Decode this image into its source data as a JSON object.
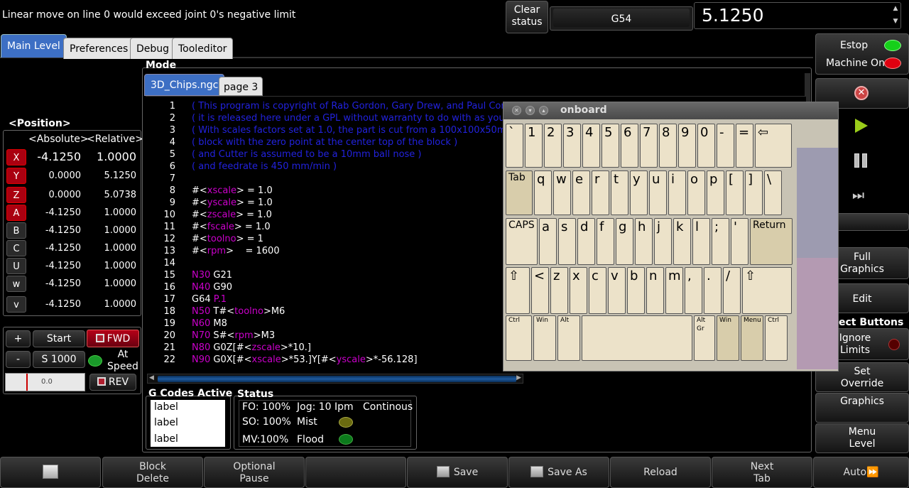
{
  "status_message": "Linear move on line 0 would exceed joint 0's negative limit",
  "clear_status": [
    "Clear",
    "status"
  ],
  "coord_system": "G54",
  "spindle_entry": "5.1250",
  "tabs": [
    "Main Level",
    "Preferences",
    "Debug",
    "Tooleditor"
  ],
  "position": {
    "title": "<Position>",
    "col_absolute": "<Absolute>",
    "col_relative": "<Relative>",
    "axes": [
      {
        "axis": "X",
        "abs": "-4.1250",
        "rel": "1.0000"
      },
      {
        "axis": "Y",
        "abs": "0.0000",
        "rel": "5.1250"
      },
      {
        "axis": "Z",
        "abs": "0.0000",
        "rel": "5.0738"
      },
      {
        "axis": "A",
        "abs": "-4.1250",
        "rel": "1.0000"
      },
      {
        "axis": "B",
        "abs": "-4.1250",
        "rel": "1.0000"
      },
      {
        "axis": "C",
        "abs": "-4.1250",
        "rel": "1.0000"
      },
      {
        "axis": "U",
        "abs": "-4.1250",
        "rel": "1.0000"
      },
      {
        "axis": "w",
        "abs": "-4.1250",
        "rel": "1.0000"
      },
      {
        "axis": "v",
        "abs": "-4.1250",
        "rel": "1.0000"
      }
    ]
  },
  "jog": {
    "plus": "+",
    "minus": "-",
    "start": "Start",
    "spindle_speed": "S 1000",
    "fwd": "FWD",
    "rev": "REV",
    "at_speed": [
      "At",
      "Speed"
    ],
    "slider_value": "0.0"
  },
  "mode": {
    "title": "Mode",
    "file_tab": "3D_Chips.ngc",
    "page_tab": "page 3"
  },
  "gcode_active": {
    "title": "G Codes Active",
    "items": [
      "label",
      "label",
      "label"
    ]
  },
  "status": {
    "title": "Status",
    "fo": "FO: 100%",
    "jog": "Jog: 10 Ipm",
    "mode": "Continous",
    "so": "SO: 100%",
    "mist": "Mist",
    "mv": "MV:100%",
    "flood": "Flood"
  },
  "right_panel": {
    "estop": "Estop",
    "machine_on": "Machine On",
    "full_graphics": [
      "Full",
      "Graphics"
    ],
    "edit": "Edit",
    "select_buttons": "ect Buttons",
    "ignore_limits": [
      "Ignore",
      "Limits"
    ],
    "set_override": [
      "Set",
      "Override"
    ],
    "graphics": "Graphics",
    "menu_level": [
      "Menu",
      "Level"
    ]
  },
  "bottom_bar": {
    "block_delete": [
      "Block",
      "Delete"
    ],
    "optional_pause": [
      "Optional",
      "Pause"
    ],
    "save": "Save",
    "save_as": "Save As",
    "reload": "Reload",
    "next_tab": [
      "Next",
      "Tab"
    ],
    "auto": "Auto"
  },
  "keyboard": {
    "title": "onboard",
    "row1": [
      "`",
      "1",
      "2",
      "3",
      "4",
      "5",
      "6",
      "7",
      "8",
      "9",
      "0",
      "-",
      "="
    ],
    "row2": [
      "Tab",
      "q",
      "w",
      "e",
      "r",
      "t",
      "y",
      "u",
      "i",
      "o",
      "p",
      "[",
      "]",
      "\\"
    ],
    "row3": [
      "CAPS",
      "a",
      "s",
      "d",
      "f",
      "g",
      "h",
      "j",
      "k",
      "l",
      ";",
      "'",
      "Return"
    ],
    "row4": [
      "⇧",
      "<",
      "z",
      "x",
      "c",
      "v",
      "b",
      "n",
      "m",
      ",",
      ".",
      "/",
      "⇧"
    ],
    "row5": [
      "Ctrl",
      "Win",
      "Alt",
      "",
      "Alt Gr",
      "Win",
      "Menu",
      "Ctrl"
    ],
    "backspace": "⇦"
  },
  "gcode_lines": [
    {
      "n": "1",
      "t": "( This program is copyright of Rab Gordon, Gary Drew, and Paul Corner",
      "c": "cm"
    },
    {
      "n": "2",
      "t": "( it is released here under a GPL without warranty to do with as you wish",
      "c": "cm"
    },
    {
      "n": "3",
      "t": "( With scales factors set at 1.0, the part is cut from a 100x100x50mm",
      "c": "cm"
    },
    {
      "n": "4",
      "t": "( block with the zero point at the center top of the block )",
      "c": "cm"
    },
    {
      "n": "5",
      "t": "( and Cutter is assumed to be a 10mm ball nose )",
      "c": "cm"
    },
    {
      "n": "6",
      "t": "( and feedrate is 450 mm/min )",
      "c": "cm"
    },
    {
      "n": "7",
      "t": "",
      "c": ""
    },
    {
      "n": "8",
      "t": "#<xscale> = 1.0",
      "c": ""
    },
    {
      "n": "9",
      "t": "#<yscale> = 1.0",
      "c": ""
    },
    {
      "n": "10",
      "t": "#<zscale> = 1.0",
      "c": ""
    },
    {
      "n": "11",
      "t": "#<fscale> = 1.0",
      "c": ""
    },
    {
      "n": "12",
      "t": "#<toolno> = 1",
      "c": ""
    },
    {
      "n": "13",
      "t": "#<rpm>    = 1600",
      "c": ""
    },
    {
      "n": "14",
      "t": "",
      "c": ""
    },
    {
      "n": "15",
      "t": "N30 G21",
      "c": ""
    },
    {
      "n": "16",
      "t": "N40 G90",
      "c": ""
    },
    {
      "n": "17",
      "t": "G64 P.1",
      "c": ""
    },
    {
      "n": "18",
      "t": "N50 T#<toolno>M6",
      "c": ""
    },
    {
      "n": "19",
      "t": "N60 M8",
      "c": ""
    },
    {
      "n": "20",
      "t": "N70 S#<rpm>M3",
      "c": ""
    },
    {
      "n": "21",
      "t": "N80 G0Z[#<zscale>*10.]",
      "c": ""
    },
    {
      "n": "22",
      "t": "N90 G0X[#<xscale>*53.]Y[#<yscale>*-56.128]",
      "c": ""
    }
  ]
}
